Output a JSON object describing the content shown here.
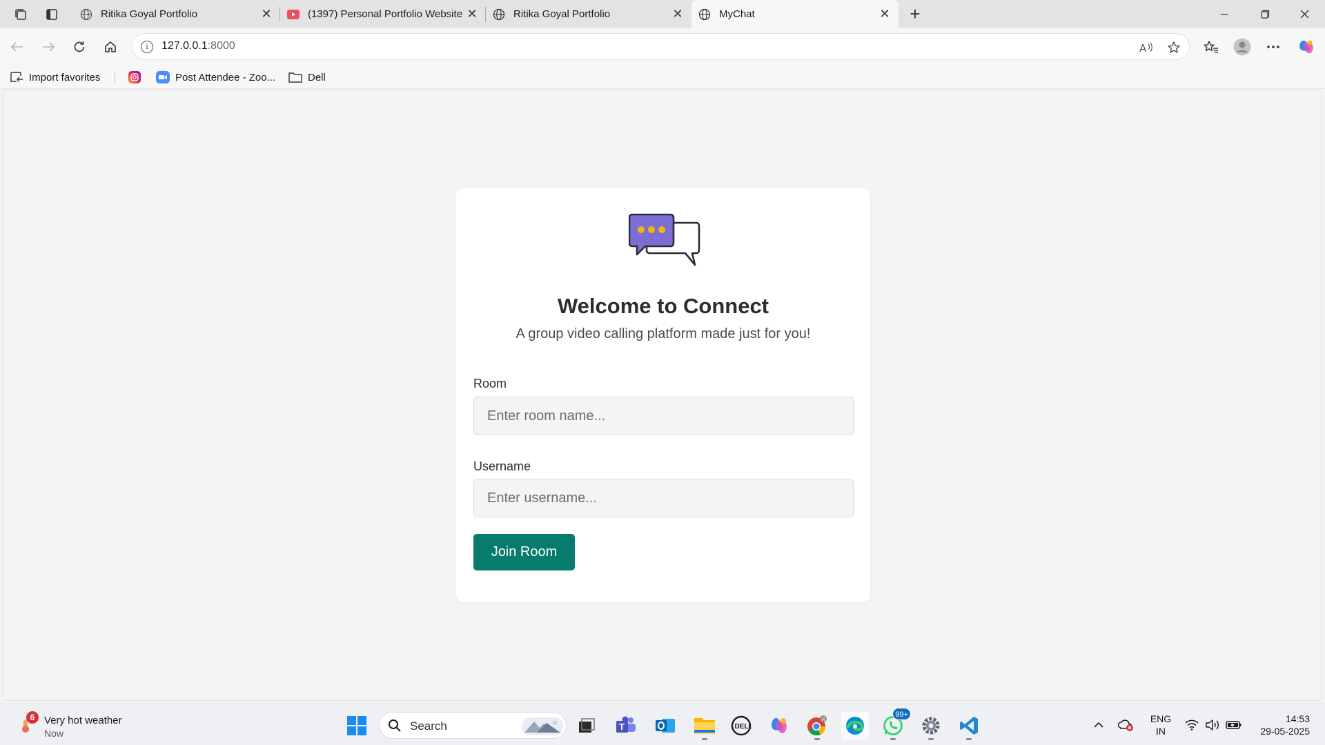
{
  "browser": {
    "tabs": [
      {
        "title": "Ritika Goyal Portfolio",
        "favicon": "globe-icon"
      },
      {
        "title": "(1397) Personal Portfolio Website",
        "favicon": "youtube-icon"
      },
      {
        "title": "Ritika Goyal Portfolio",
        "favicon": "globe-icon"
      },
      {
        "title": "MyChat",
        "favicon": "globe-icon",
        "active": true
      }
    ],
    "url_host": "127.0.0.1",
    "url_port": ":8000",
    "favorites": [
      {
        "label": "Import favorites",
        "icon": "import-icon"
      },
      {
        "label": "",
        "icon": "instagram-icon"
      },
      {
        "label": "Post Attendee - Zoo...",
        "icon": "zoom-icon"
      },
      {
        "label": "Dell",
        "icon": "folder-icon"
      }
    ]
  },
  "page": {
    "title": "Welcome to Connect",
    "subtitle": "A group video calling platform made just for you!",
    "room_label": "Room",
    "room_placeholder": "Enter room name...",
    "room_value": "",
    "username_label": "Username",
    "username_placeholder": "Enter username...",
    "username_value": "",
    "join_button": "Join Room",
    "colors": {
      "accent": "#077c6c",
      "logo_bubble": "#7b6fd6",
      "logo_dots": "#f2b705"
    }
  },
  "taskbar": {
    "weather_badge": "6",
    "weather_title": "Very hot weather",
    "weather_sub": "Now",
    "search_label": "Search",
    "whatsapp_badge": "99+",
    "lang_line1": "ENG",
    "lang_line2": "IN",
    "time": "14:53",
    "date": "29-05-2025"
  }
}
